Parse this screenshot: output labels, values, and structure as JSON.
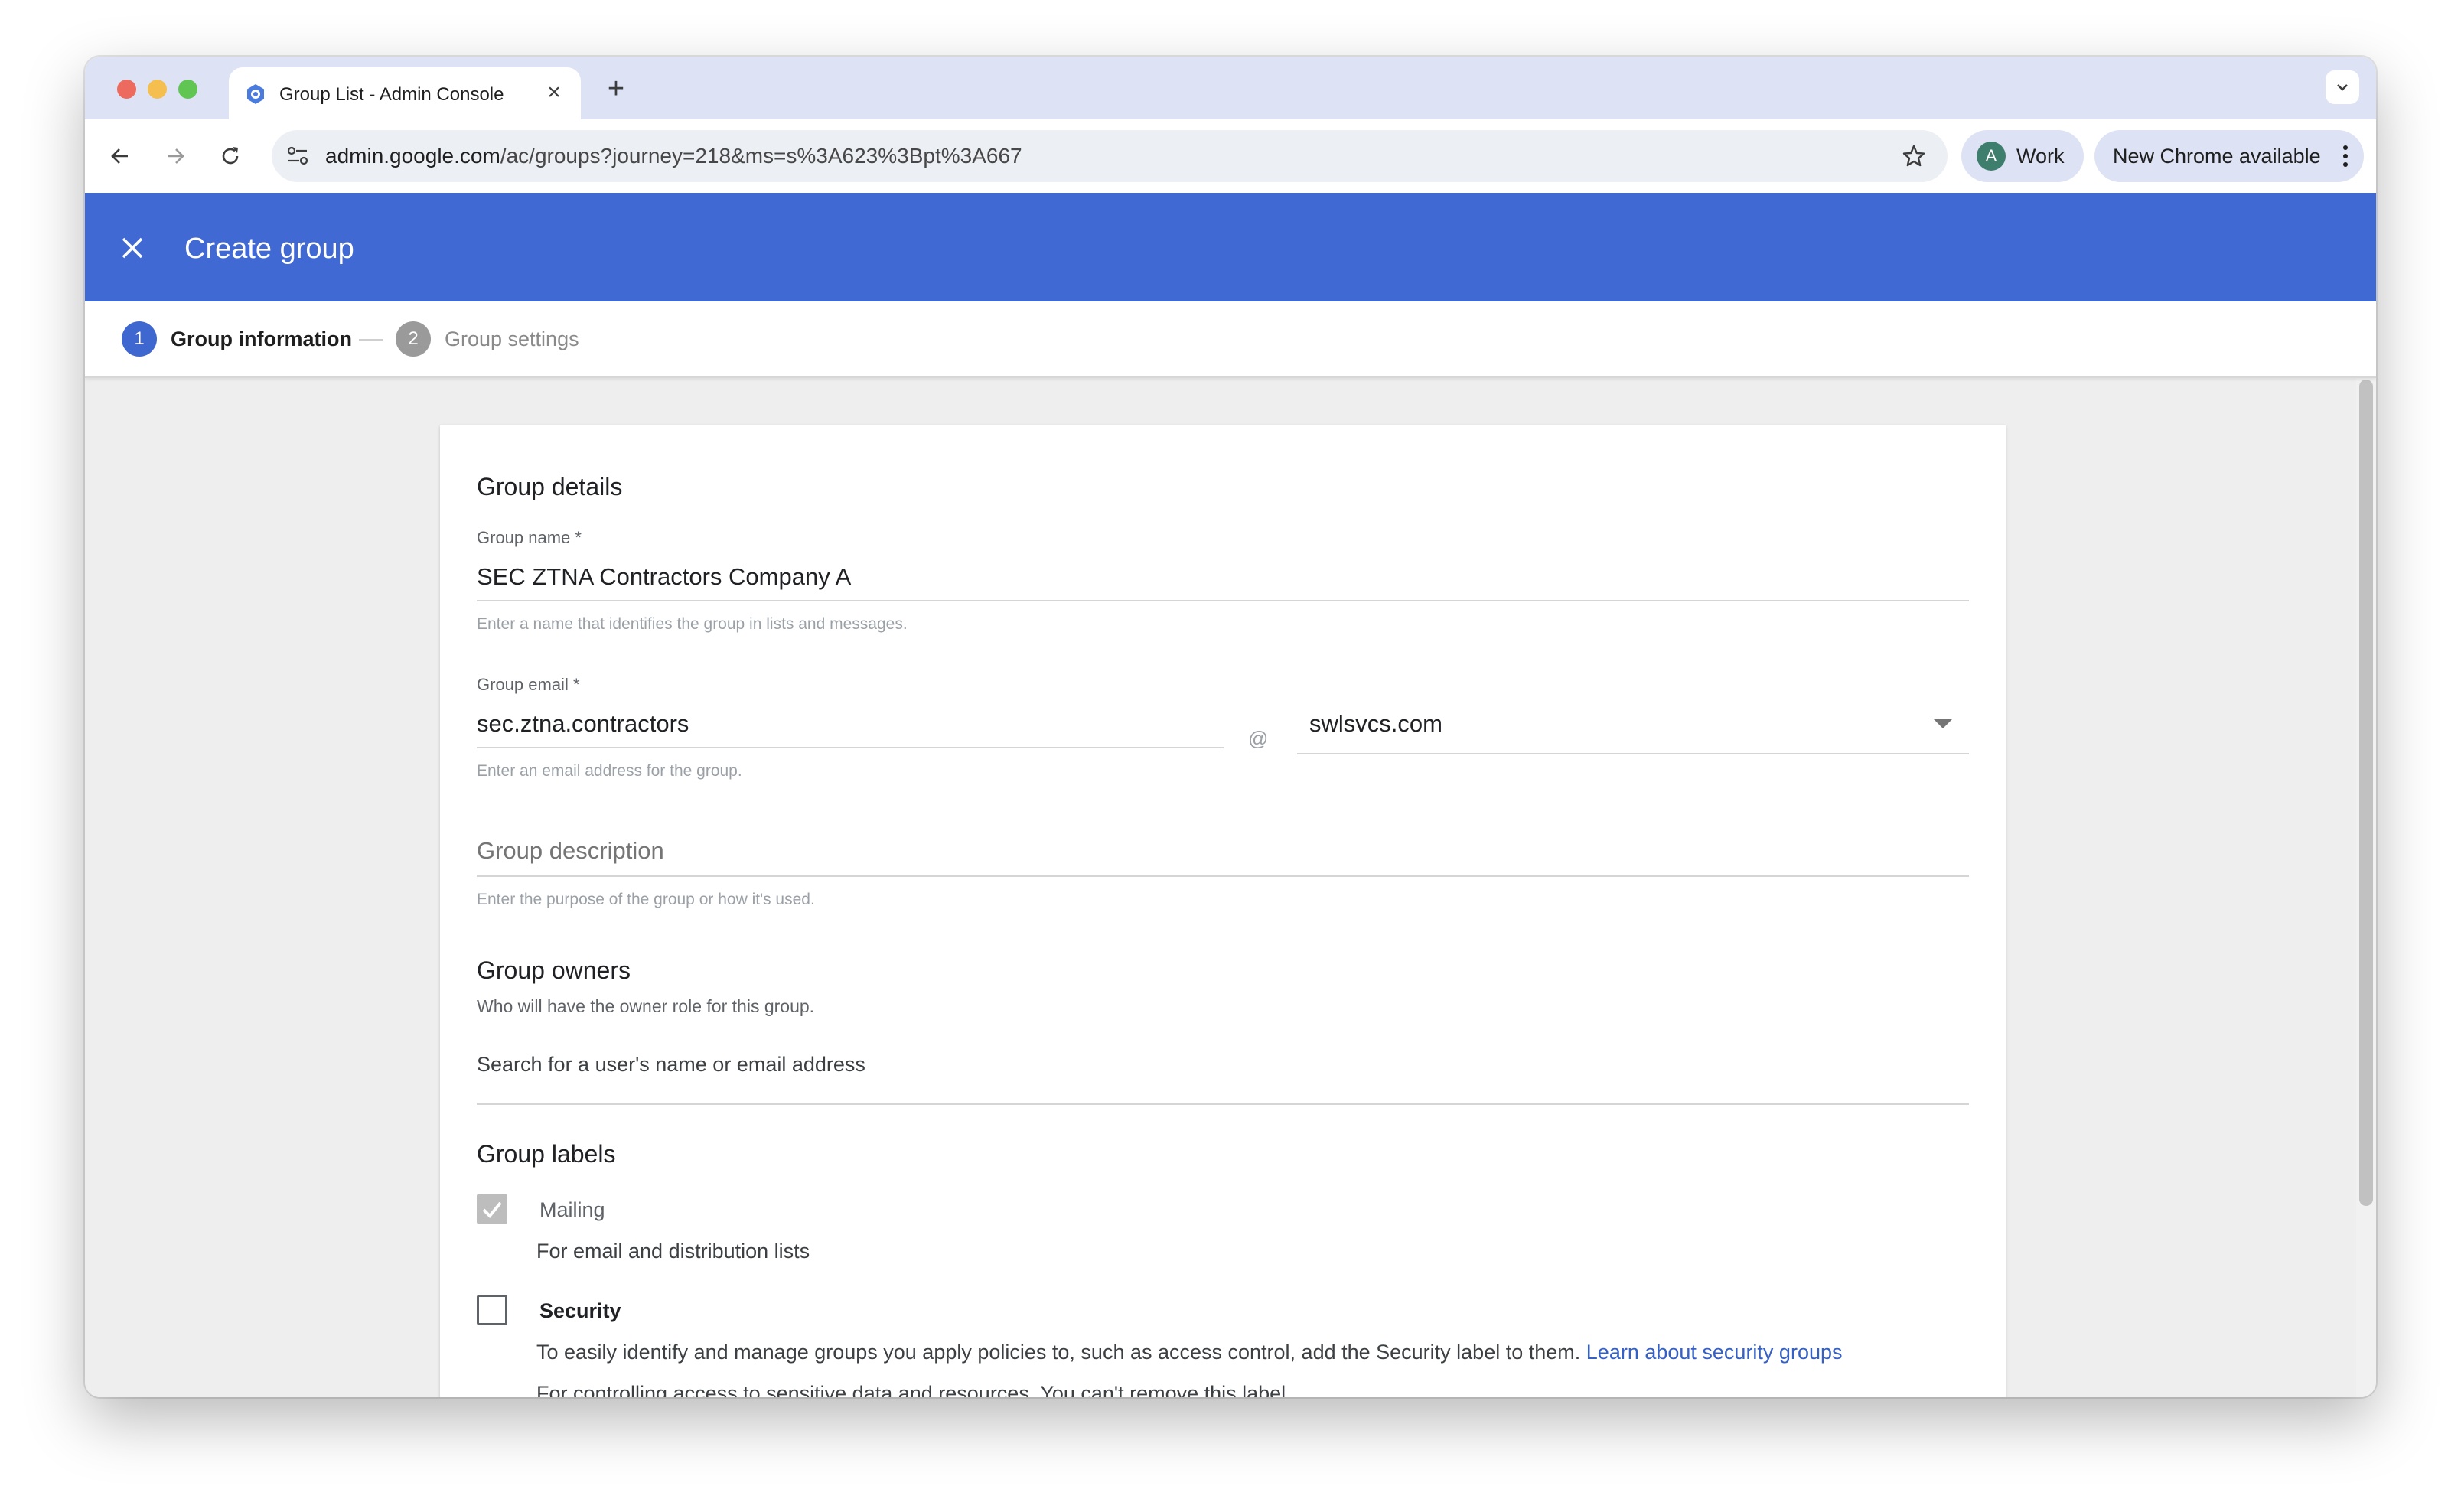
{
  "browser": {
    "tab_title": "Group List - Admin Console",
    "url_host": "admin.google.com",
    "url_path": "/ac/groups?journey=218&ms=s%3A623%3Bpt%3A667",
    "profile_initial": "A",
    "profile_label": "Work",
    "update_label": "New Chrome available"
  },
  "header": {
    "title": "Create group"
  },
  "stepper": {
    "steps": [
      {
        "number": "1",
        "label": "Group information"
      },
      {
        "number": "2",
        "label": "Group settings"
      }
    ]
  },
  "form": {
    "details_title": "Group details",
    "group_name": {
      "label": "Group name *",
      "value": "SEC ZTNA Contractors Company A",
      "helper": "Enter a name that identifies the group in lists and messages."
    },
    "group_email": {
      "label": "Group email *",
      "value": "sec.ztna.contractors",
      "at": "@",
      "domain": "swlsvcs.com",
      "helper": "Enter an email address for the group."
    },
    "group_description": {
      "placeholder": "Group description",
      "helper": "Enter the purpose of the group or how it's used."
    },
    "owners": {
      "title": "Group owners",
      "subtitle": "Who will have the owner role for this group.",
      "placeholder": "Search for a user's name or email address"
    },
    "labels": {
      "title": "Group labels",
      "mailing": {
        "label": "Mailing",
        "desc": "For email and distribution lists",
        "checked": true
      },
      "security": {
        "label": "Security",
        "desc": "To easily identify and manage groups you apply policies to, such as access control, add the Security label to them.",
        "link": "Learn about security groups",
        "desc2": "For controlling access to sensitive data and resources. You can't remove this label.",
        "checked": false
      }
    }
  },
  "colors": {
    "header_bg": "#4169d3",
    "step_active": "#3f67d0",
    "link": "#3560c6"
  }
}
